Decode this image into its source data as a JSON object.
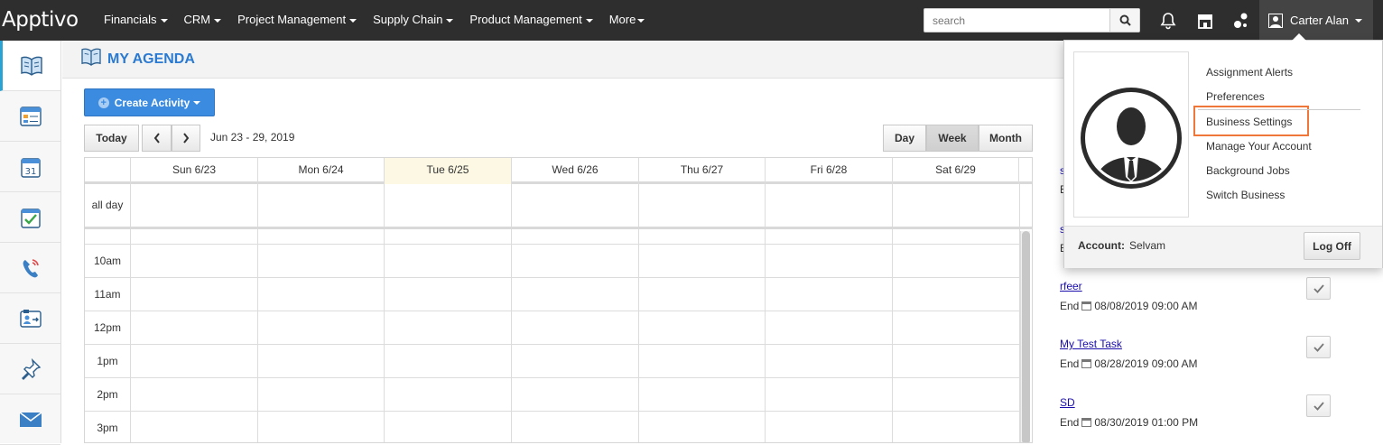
{
  "app": {
    "logo_text": "Apptivo"
  },
  "topnav": {
    "items": [
      {
        "label": "Financials"
      },
      {
        "label": "CRM"
      },
      {
        "label": "Project Management"
      },
      {
        "label": "Supply Chain"
      },
      {
        "label": "Product Management"
      },
      {
        "label": "More"
      }
    ]
  },
  "search": {
    "placeholder": "search"
  },
  "user": {
    "name": "Carter Alan"
  },
  "page": {
    "title": "MY AGENDA"
  },
  "toolbar": {
    "create_label": "Create Activity",
    "today_label": "Today",
    "date_range": "Jun 23 - 29, 2019",
    "views": [
      "Day",
      "Week",
      "Month"
    ],
    "active_view": "Week"
  },
  "calendar": {
    "days": [
      "Sun 6/23",
      "Mon 6/24",
      "Tue 6/25",
      "Wed 6/26",
      "Thu 6/27",
      "Fri 6/28",
      "Sat 6/29"
    ],
    "today_index": 2,
    "allday_label": "all day",
    "hours": [
      "10am",
      "11am",
      "12pm",
      "1pm",
      "2pm",
      "3pm"
    ]
  },
  "tasks": [
    {
      "title": "rfeer",
      "end_label": "End",
      "end": "08/08/2019 09:00 AM"
    },
    {
      "title": "My Test Task",
      "end_label": "End",
      "end": "08/28/2019 09:00 AM"
    },
    {
      "title": "SD",
      "end_label": "End",
      "end": "08/30/2019 01:00 PM"
    }
  ],
  "user_popup": {
    "menu": [
      "Assignment Alerts",
      "Preferences",
      "Business Settings",
      "Manage Your Account",
      "Background Jobs",
      "Switch Business"
    ],
    "highlighted": "Business Settings",
    "account_label": "Account:",
    "account_value": "Selvam",
    "logoff_label": "Log Off"
  },
  "colors": {
    "topbar": "#2e2e2e",
    "accent": "#2a7ad2",
    "create_button": "#3b8be0",
    "highlight": "#f0773a",
    "today_bg": "#fcf8e3"
  }
}
